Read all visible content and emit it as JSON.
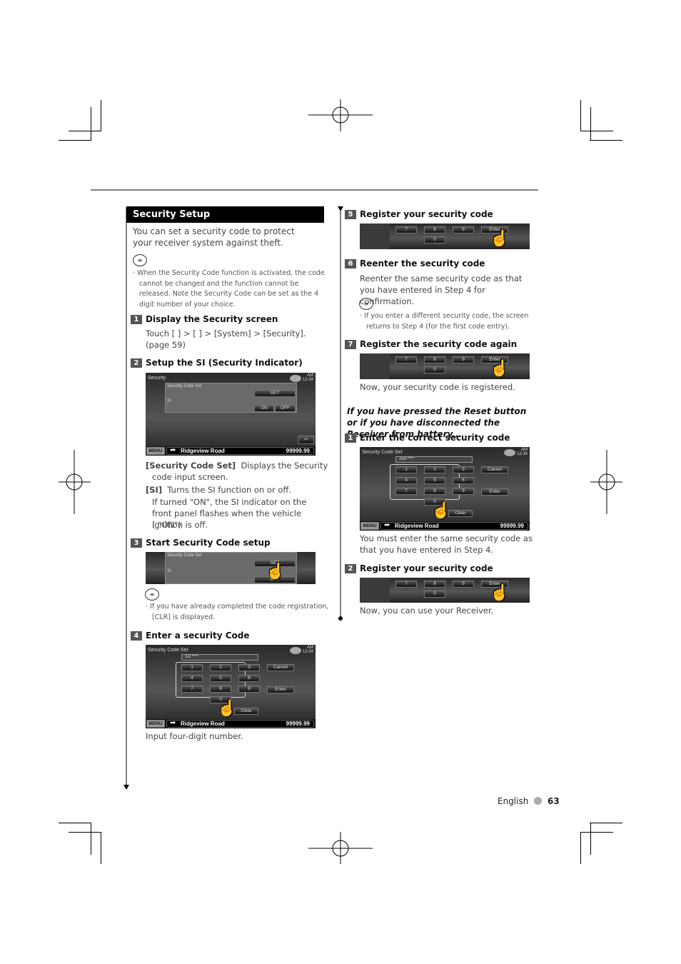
{
  "section_title": "Security Setup",
  "intro": "You can set a security code to protect your receiver system against theft.",
  "note1": "When the Security Code function is activated, the code cannot be changed and the function cannot be released. Note the Security Code can be set as the 4 digit number of your choice.",
  "steps_left": [
    {
      "num": "1",
      "title": "Display the Security screen",
      "body": "Touch [ ] > [ ] > [System] > [Security]. (page 59)"
    },
    {
      "num": "2",
      "title": "Setup the SI (Security Indicator)"
    },
    {
      "num": "3",
      "title": "Start Security Code setup"
    },
    {
      "num": "4",
      "title": "Enter a security Code",
      "after": "Input four-digit number."
    }
  ],
  "si_desc": {
    "label1": "[Security Code Set]",
    "text1": "Displays the Security code input screen.",
    "label2": "[SI]",
    "text2": "Turns the SI function on or off.",
    "text3": "If turned \"ON\", the SI indicator on the front panel flashes when the vehicle ignition is off.",
    "text4": "( \"ON\")"
  },
  "note2": "If you have already completed the code registration, [CLR] is displayed.",
  "steps_right": [
    {
      "num": "5",
      "title": "Register your security code"
    },
    {
      "num": "6",
      "title": "Reenter the security code",
      "body": "Reenter the same security code as that you have entered in Step 4 for confirmation.",
      "note": "If you enter a different security code, the screen returns to Step 4 (for the first code entry)."
    },
    {
      "num": "7",
      "title": "Register the security code again",
      "after": "Now, your security code is registered."
    }
  ],
  "reset_heading": "If you have pressed the Reset button or if you have disconnected the Receiver from battery...",
  "reset_steps": [
    {
      "num": "1",
      "title": "Enter the correct security code",
      "after": "You must enter the same security code as that you have entered in Step 4."
    },
    {
      "num": "2",
      "title": "Register your security code",
      "after": "Now, you can use your Receiver."
    }
  ],
  "screen": {
    "security": "Security",
    "code_set": "Security Code Set",
    "set": "SET",
    "si": "SI",
    "on": "ON",
    "off": "OFF",
    "menu": "MENU",
    "road": "Ridgeview Road",
    "dist": "99999.99",
    "am": "AM",
    "time": "12:34",
    "first": "1st",
    "second": "2nd",
    "mask": "****",
    "cancel": "Cancel",
    "enter": "Enter",
    "clear": "Clear",
    "keys": [
      "1",
      "2",
      "3",
      "4",
      "5",
      "6",
      "7",
      "8",
      "9",
      "0"
    ]
  },
  "footer": {
    "language": "English",
    "page": "63"
  }
}
